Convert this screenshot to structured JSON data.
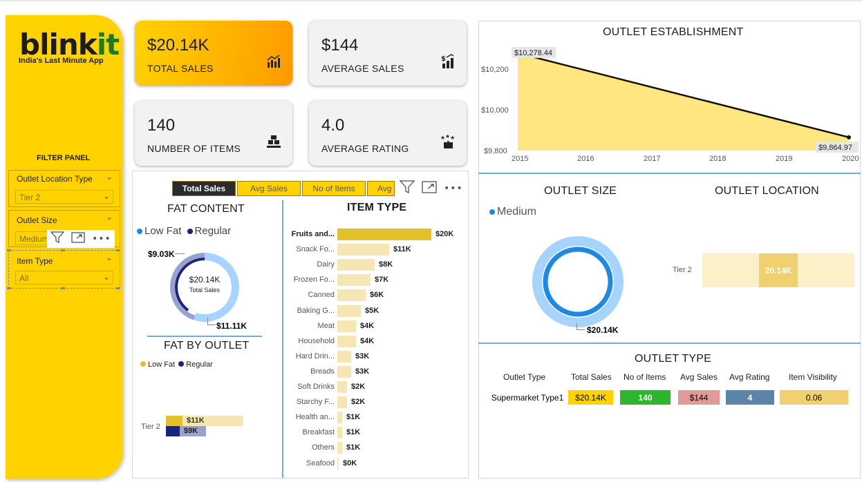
{
  "brand": {
    "logo_part1": "blink",
    "logo_part2": "it",
    "tagline": "India's Last Minute App"
  },
  "filter_panel": {
    "title": "FILTER PANEL",
    "slicers": [
      {
        "label": "Outlet Location Type",
        "value": "Tier 2"
      },
      {
        "label": "Outlet Size",
        "value": "Medium"
      },
      {
        "label": "Item Type",
        "value": "All"
      }
    ]
  },
  "kpis": [
    {
      "value": "$20.14K",
      "label": "TOTAL SALES",
      "icon": "bar-chart-icon"
    },
    {
      "value": "$144",
      "label": "AVERAGE SALES",
      "icon": "dollar-growth-icon"
    },
    {
      "value": "140",
      "label": "NUMBER OF ITEMS",
      "icon": "boxes-icon"
    },
    {
      "value": "4.0",
      "label": "AVERAGE RATING",
      "icon": "rating-stars-icon"
    }
  ],
  "tabs": [
    "Total Sales",
    "Avg Sales",
    "No of Items",
    "Avg"
  ],
  "fat_content": {
    "title": "FAT CONTENT",
    "legend": [
      "Low Fat",
      "Regular"
    ],
    "center_value": "$20.14K",
    "center_label": "Total Sales",
    "low_fat_label": "$11.11K",
    "regular_label": "$9.03K",
    "colors": {
      "low_fat": "#a6d4ff",
      "regular": "#1a237e",
      "regular_light": "#9aa0d0"
    }
  },
  "fat_by_outlet": {
    "title": "FAT BY OUTLET",
    "legend": [
      "Low Fat",
      "Regular"
    ],
    "row_label": "Tier 2",
    "low_fat_label": "$11K",
    "regular_label": "$9K",
    "colors": {
      "low_fat": "#e2c12b",
      "regular": "#1a237e"
    }
  },
  "item_type": {
    "title": "ITEM TYPE",
    "items": [
      {
        "label": "Fruits and...",
        "value": "$20K",
        "amount": 20
      },
      {
        "label": "Snack Fo...",
        "value": "$11K",
        "amount": 11
      },
      {
        "label": "Dairy",
        "value": "$8K",
        "amount": 8
      },
      {
        "label": "Frozen Fo...",
        "value": "$7K",
        "amount": 7
      },
      {
        "label": "Canned",
        "value": "$6K",
        "amount": 6
      },
      {
        "label": "Baking G...",
        "value": "$5K",
        "amount": 5
      },
      {
        "label": "Meat",
        "value": "$4K",
        "amount": 4
      },
      {
        "label": "Household",
        "value": "$4K",
        "amount": 4
      },
      {
        "label": "Hard Drin...",
        "value": "$3K",
        "amount": 3
      },
      {
        "label": "Breads",
        "value": "$3K",
        "amount": 3
      },
      {
        "label": "Soft Drinks",
        "value": "$2K",
        "amount": 2
      },
      {
        "label": "Starchy F...",
        "value": "$2K",
        "amount": 2
      },
      {
        "label": "Health an...",
        "value": "$1K",
        "amount": 1
      },
      {
        "label": "Breakfast",
        "value": "$1K",
        "amount": 1
      },
      {
        "label": "Others",
        "value": "$1K",
        "amount": 1
      },
      {
        "label": "Seafood",
        "value": "$0K",
        "amount": 0
      }
    ]
  },
  "outlet_establishment": {
    "title": "OUTLET ESTABLISHMENT",
    "y_ticks": [
      "$10,200",
      "$10,000",
      "$9,800"
    ],
    "x_ticks": [
      "2015",
      "2016",
      "2017",
      "2018",
      "2019",
      "2020"
    ],
    "start_label": "$10,278.44",
    "end_label": "$9,864.97"
  },
  "outlet_size": {
    "title": "OUTLET SIZE",
    "legend": "Medium",
    "value_label": "$20.14K"
  },
  "outlet_location": {
    "title": "OUTLET LOCATION",
    "row_label": "Tier 2",
    "value_label": "20.14K"
  },
  "outlet_type": {
    "title": "OUTLET TYPE",
    "headers": [
      "Outlet Type",
      "Total Sales",
      "No of Items",
      "Avg Sales",
      "Avg Rating",
      "Item Visibility"
    ],
    "row": [
      "Supermarket Type1",
      "$20.14K",
      "140",
      "$144",
      "4",
      "0.06"
    ],
    "cell_colors": [
      "#ffd200",
      "#2db52d",
      "#e09a9a",
      "#5b84a8",
      "#f0d070"
    ]
  },
  "chart_data": [
    {
      "type": "area",
      "title": "OUTLET ESTABLISHMENT",
      "x": [
        2015,
        2020
      ],
      "y": [
        10278.44,
        9864.97
      ],
      "xlim": [
        2015,
        2020
      ],
      "ylim": [
        9800,
        10300
      ]
    },
    {
      "type": "pie",
      "title": "FAT CONTENT",
      "categories": [
        "Low Fat",
        "Regular"
      ],
      "values": [
        11.11,
        9.03
      ]
    },
    {
      "type": "bar",
      "title": "ITEM TYPE",
      "categories": [
        "Fruits and...",
        "Snack Fo...",
        "Dairy",
        "Frozen Fo...",
        "Canned",
        "Baking G...",
        "Meat",
        "Household",
        "Hard Drin...",
        "Breads",
        "Soft Drinks",
        "Starchy F...",
        "Health an...",
        "Breakfast",
        "Others",
        "Seafood"
      ],
      "values": [
        20,
        11,
        8,
        7,
        6,
        5,
        4,
        4,
        3,
        3,
        2,
        2,
        1,
        1,
        1,
        0
      ]
    },
    {
      "type": "bar",
      "title": "FAT BY OUTLET",
      "categories": [
        "Tier 2"
      ],
      "series": [
        {
          "name": "Low Fat",
          "values": [
            11
          ]
        },
        {
          "name": "Regular",
          "values": [
            9
          ]
        }
      ]
    }
  ]
}
